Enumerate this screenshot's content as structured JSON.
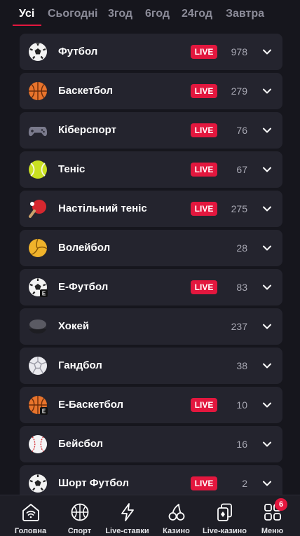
{
  "tabs": [
    {
      "label": "Усі",
      "active": true
    },
    {
      "label": "Сьогодні",
      "active": false
    },
    {
      "label": "3год",
      "active": false
    },
    {
      "label": "6год",
      "active": false
    },
    {
      "label": "24год",
      "active": false
    },
    {
      "label": "Завтра",
      "active": false
    }
  ],
  "live_label": "LIVE",
  "sports": [
    {
      "name": "Футбол",
      "live": true,
      "count": "978",
      "icon": "soccer-ball-icon"
    },
    {
      "name": "Баскетбол",
      "live": true,
      "count": "279",
      "icon": "basketball-icon"
    },
    {
      "name": "Кіберспорт",
      "live": true,
      "count": "76",
      "icon": "gamepad-icon"
    },
    {
      "name": "Теніс",
      "live": true,
      "count": "67",
      "icon": "tennis-ball-icon"
    },
    {
      "name": "Настільний теніс",
      "live": true,
      "count": "275",
      "icon": "ping-pong-paddle-icon"
    },
    {
      "name": "Волейбол",
      "live": false,
      "count": "28",
      "icon": "volleyball-icon"
    },
    {
      "name": "Е-Футбол",
      "live": true,
      "count": "83",
      "icon": "e-soccer-icon"
    },
    {
      "name": "Хокей",
      "live": false,
      "count": "237",
      "icon": "hockey-puck-icon"
    },
    {
      "name": "Гандбол",
      "live": false,
      "count": "38",
      "icon": "handball-icon"
    },
    {
      "name": "Е-Баскетбол",
      "live": true,
      "count": "10",
      "icon": "e-basketball-icon"
    },
    {
      "name": "Бейсбол",
      "live": false,
      "count": "16",
      "icon": "baseball-icon"
    },
    {
      "name": "Шорт Футбол",
      "live": true,
      "count": "2",
      "icon": "short-soccer-icon"
    }
  ],
  "bottom_nav": [
    {
      "label": "Головна",
      "icon": "home-wifi-icon"
    },
    {
      "label": "Спорт",
      "icon": "sport-ball-icon"
    },
    {
      "label": "Live-ставки",
      "icon": "lightning-icon"
    },
    {
      "label": "Казино",
      "icon": "cherries-icon"
    },
    {
      "label": "Live-казино",
      "icon": "dice-cards-icon"
    },
    {
      "label": "Меню",
      "icon": "grid-menu-icon"
    }
  ],
  "menu_badge": "6",
  "colors": {
    "background": "#16161d",
    "row_background": "#24242e",
    "accent": "#e3173e",
    "muted_text": "#8c8c99"
  }
}
